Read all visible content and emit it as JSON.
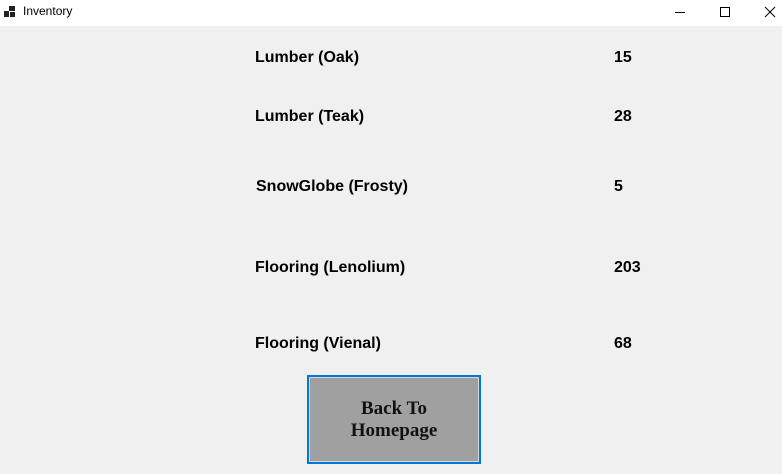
{
  "window": {
    "title": "Inventory",
    "app_icon": "window-app-icon",
    "controls": {
      "minimize_icon": "minimize-icon",
      "maximize_icon": "maximize-icon",
      "close_icon": "close-icon"
    }
  },
  "inventory": {
    "items": [
      {
        "name": "Lumber (Oak)",
        "quantity": "15"
      },
      {
        "name": "Lumber (Teak)",
        "quantity": "28"
      },
      {
        "name": "SnowGlobe (Frosty)",
        "quantity": "5"
      },
      {
        "name": "Flooring (Lenolium)",
        "quantity": "203"
      },
      {
        "name": "Flooring (Vienal)",
        "quantity": "68"
      }
    ]
  },
  "back_button": {
    "label": "Back To Homepage"
  },
  "colors": {
    "window_background": "#f0f0f0",
    "titlebar_background": "#ffffff",
    "button_background": "#a0a0a0",
    "button_focus_border": "#0078d7"
  }
}
